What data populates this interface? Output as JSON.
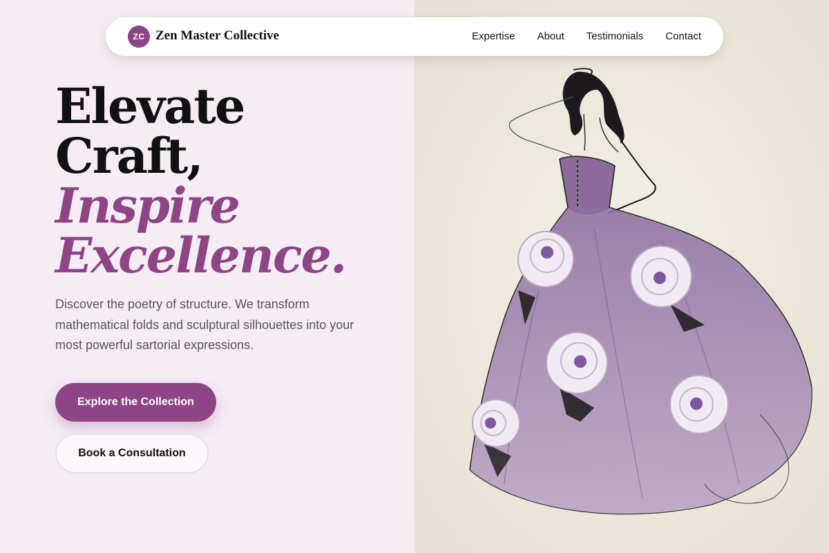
{
  "nav": {
    "logo_initials": "ZC",
    "brand": "Zen Master Collective",
    "links": [
      "Expertise",
      "About",
      "Testimonials",
      "Contact"
    ]
  },
  "hero": {
    "title_lines": [
      "Elevate",
      "Craft,"
    ],
    "accent_lines": [
      "Inspire",
      "Excellence."
    ],
    "description": "Discover the poetry of structure. We transform mathematical folds and sculptural silhouettes into your most powerful sartorial expressions.",
    "primary_cta": "Explore the Collection",
    "secondary_cta": "Book a Consultation"
  },
  "colors": {
    "accent": "#8e4585",
    "left_background": "#f5ecf4",
    "right_background": "#ede9dc",
    "heading": "#111111",
    "body_text": "#555560"
  }
}
